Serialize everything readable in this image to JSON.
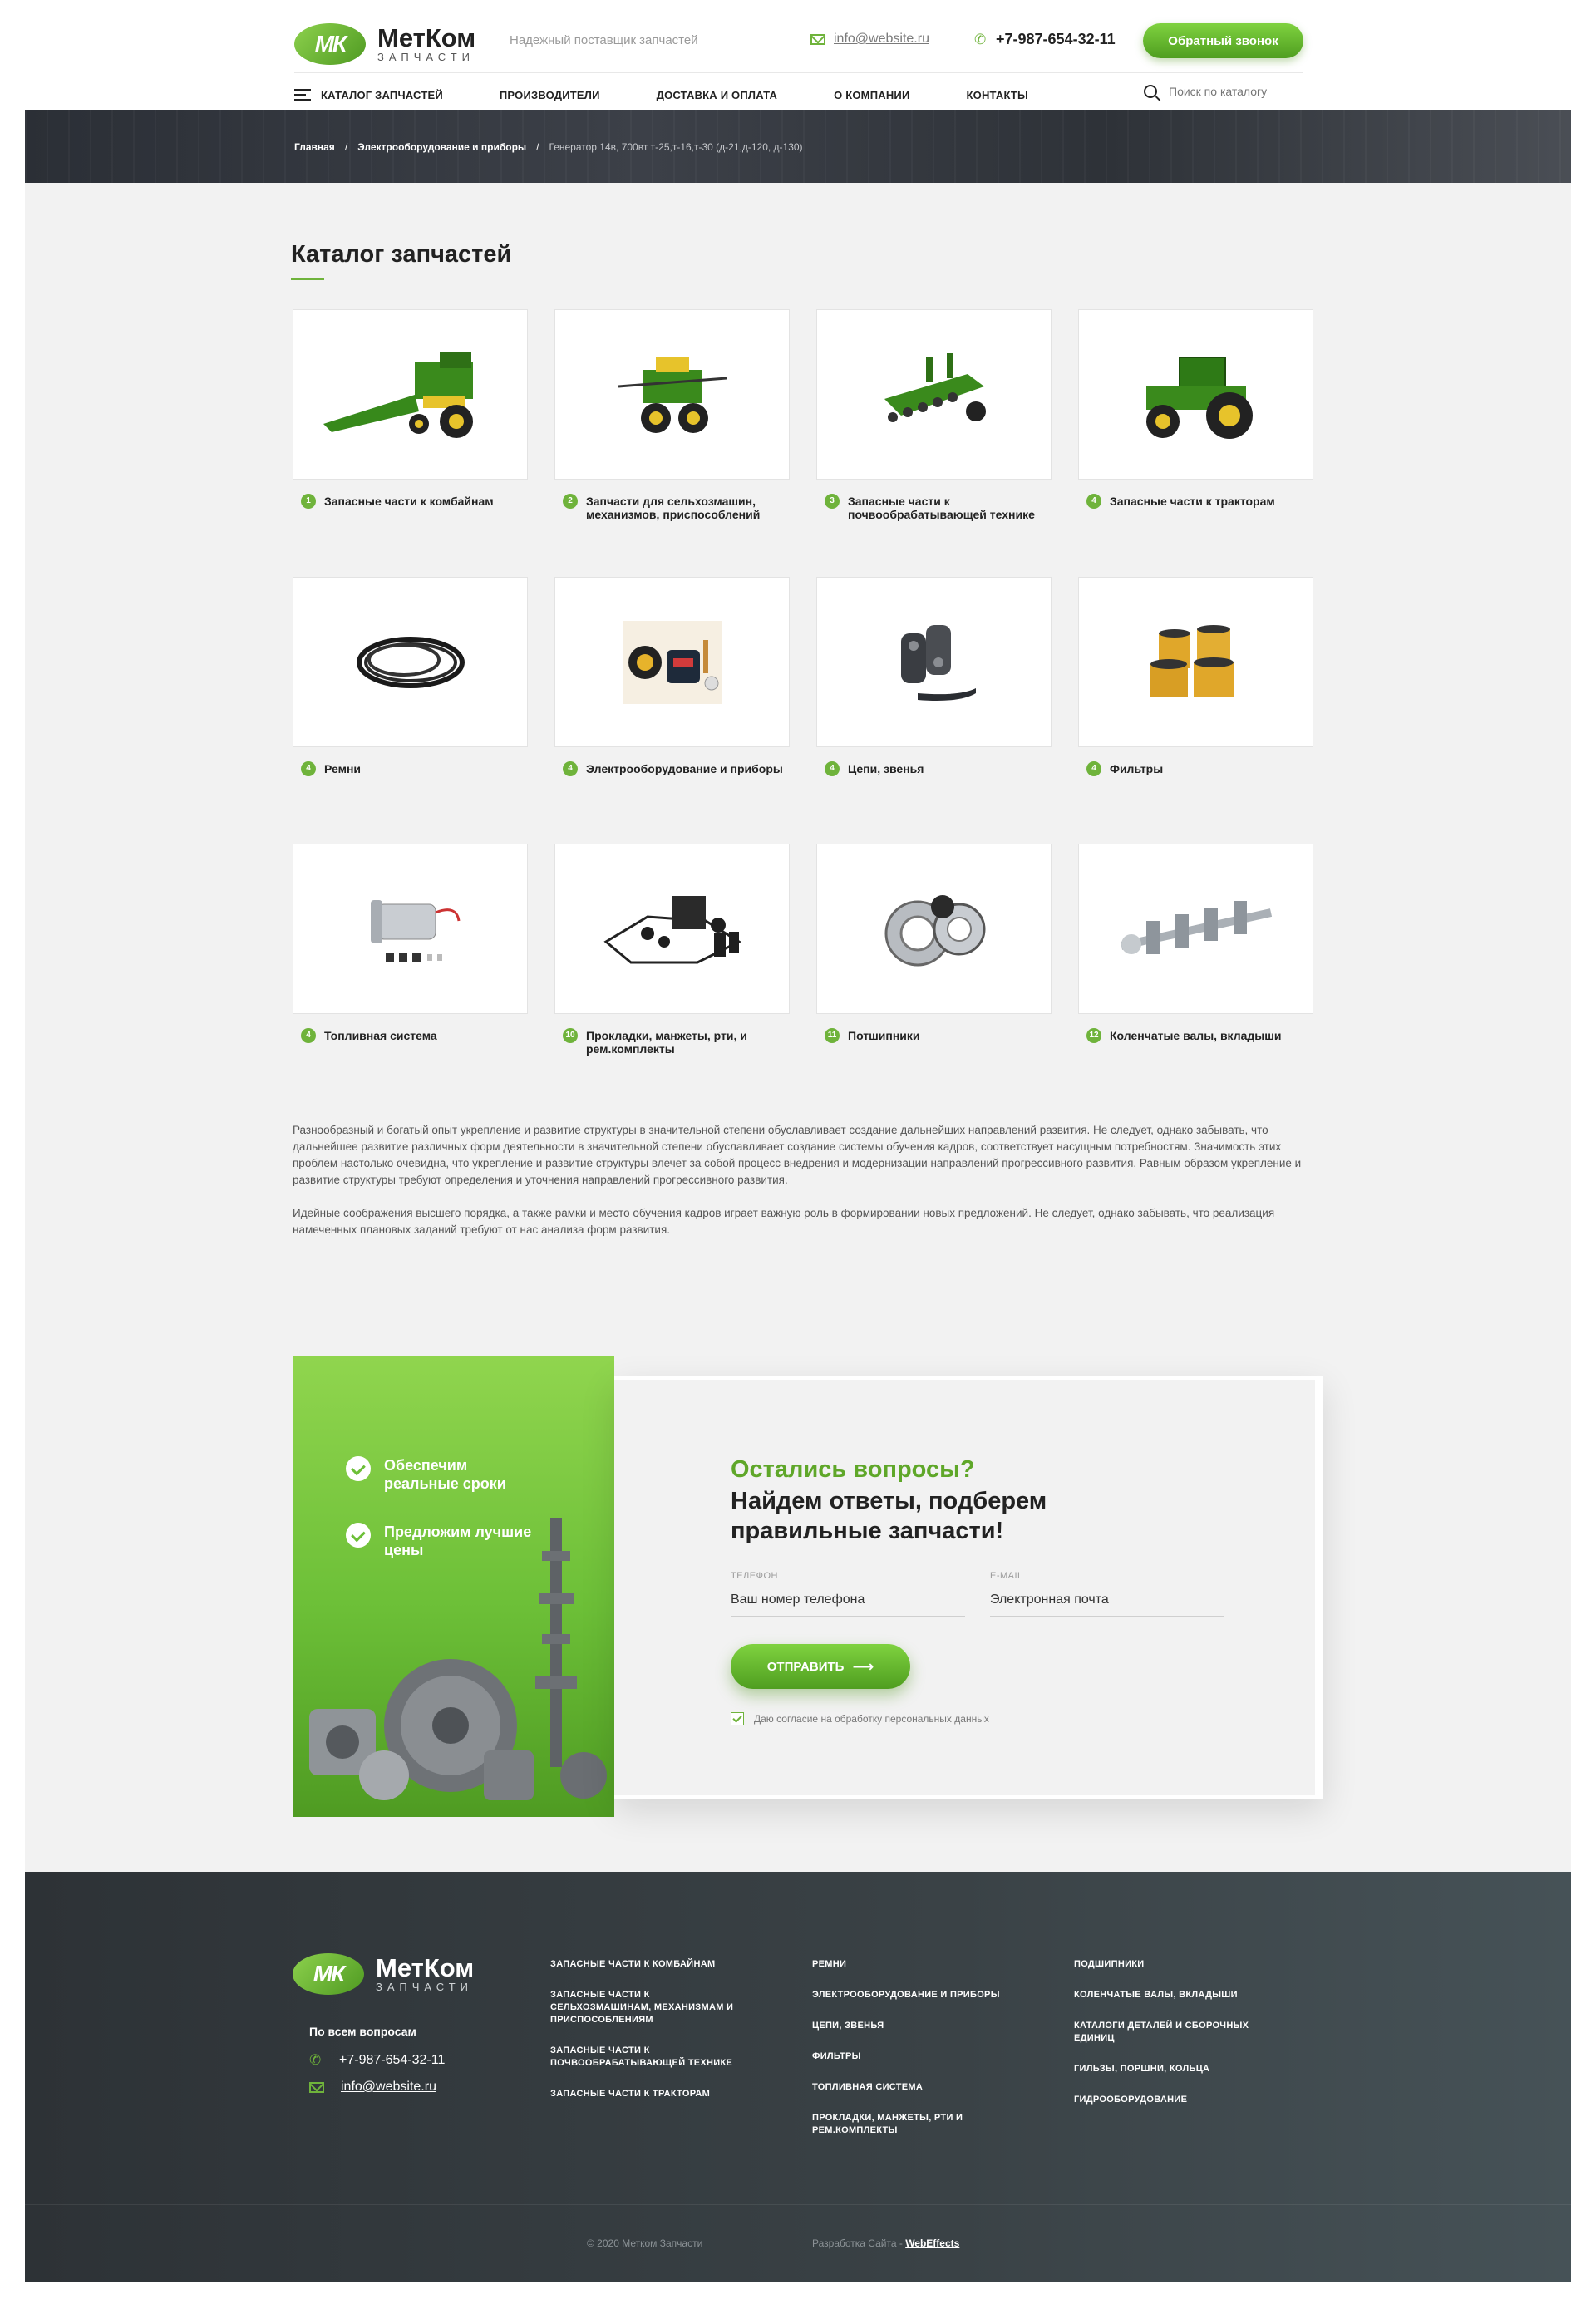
{
  "header": {
    "logo_mark": "МК",
    "logo_name": "МетКом",
    "logo_sub": "запчасти",
    "tagline": "Надежный поставщик запчастей",
    "email": "info@website.ru",
    "phone": "+7-987-654-32-11",
    "callback_button": "Обратный звонок"
  },
  "nav": {
    "items": [
      "Каталог запчастей",
      "Производители",
      "Доставка и оплата",
      "О компании",
      "Контакты"
    ],
    "search_placeholder": "Поиск по каталогу"
  },
  "breadcrumb": {
    "home": "Главная",
    "section": "Электрооборудование и приборы",
    "current": "Генератор 14в, 700вт т-25,т-16,т-30 (д-21,д-120, д-130)"
  },
  "catalog": {
    "title": "Каталог запчастей",
    "items": [
      {
        "num": "1",
        "label": "Запасные части к комбайнам",
        "icon": "combine-harvester-image"
      },
      {
        "num": "2",
        "label": "Запчасти для сельхозмашин, механизмов, приспособлений",
        "icon": "sprayer-image"
      },
      {
        "num": "3",
        "label": "Запасные части к почвообрабатывающей технике",
        "icon": "seeder-image"
      },
      {
        "num": "4",
        "label": "Запасные части к тракторам",
        "icon": "tractor-image"
      },
      {
        "num": "4",
        "label": "Ремни",
        "icon": "belts-image"
      },
      {
        "num": "4",
        "label": "Электрооборудование и приборы",
        "icon": "electrical-devices-image"
      },
      {
        "num": "4",
        "label": "Цепи, звенья",
        "icon": "chain-links-image"
      },
      {
        "num": "4",
        "label": "Фильтры",
        "icon": "filters-image"
      },
      {
        "num": "4",
        "label": "Топливная система",
        "icon": "fuel-pump-image"
      },
      {
        "num": "10",
        "label": "Прокладки, манжеты, рти, и рем.комплекты",
        "icon": "gaskets-image"
      },
      {
        "num": "11",
        "label": "Потшипники",
        "icon": "bearings-image"
      },
      {
        "num": "12",
        "label": "Коленчатые валы, вкладыши",
        "icon": "crankshaft-image"
      }
    ]
  },
  "description": {
    "p1": "Разнообразный и богатый опыт укрепление и развитие структуры в значительной степени обуславливает создание дальнейших направлений развития. Не следует, однако забывать, что дальнейшее развитие различных форм деятельности в значительной степени обуславливает создание системы обучения кадров, соответствует насущным потребностям. Значимость этих проблем настолько очевидна, что укрепление и развитие структуры влечет за собой процесс внедрения и модернизации направлений прогрессивного развития. Равным образом укрепление и развитие структуры требуют определения и уточнения направлений прогрессивного развития.",
    "p2": "Идейные соображения высшего порядка, а также рамки и место обучения кадров играет важную роль в формировании новых предложений. Не следует, однако забывать, что реализация намеченных плановых заданий требуют от нас анализа форм развития."
  },
  "promo": {
    "benefit1": "Обеспечим реальные сроки",
    "benefit2": "Предложим лучшие цены"
  },
  "form": {
    "question": "Остались вопросы?",
    "heading": "Найдем ответы, подберем правильные запчасти!",
    "phone_label": "Телефон",
    "phone_placeholder": "Ваш номер телефона",
    "email_label": "E-mail",
    "email_placeholder": "Электронная почта",
    "submit": "Отправить",
    "consent": "Даю согласие на обработку персональных данных"
  },
  "footer": {
    "logo_mark": "МК",
    "logo_name": "МетКом",
    "logo_sub": "запчасти",
    "contacts_label": "По всем вопросам",
    "phone": "+7-987-654-32-11",
    "email": "info@website.ru",
    "col1": [
      "Запасные части к комбайнам",
      "Запасные части к сельхозмашинам, механизмам и приспособлениям",
      "Запасные части к почвообрабатывающей технике",
      "Запасные части к тракторам"
    ],
    "col2": [
      "Ремни",
      "Электрооборудование и приборы",
      "Цепи, звенья",
      "Фильтры",
      "Топливная система",
      "Прокладки, манжеты, рти и рем.комплекты"
    ],
    "col3": [
      "Подшипники",
      "Коленчатые валы, вкладыши",
      "Каталоги деталей и сборочных единиц",
      "Гильзы, поршни, кольца",
      "Гидрооборудование"
    ],
    "copyright": "© 2020 Метком Запчасти",
    "dev_prefix": "Разработка Сайта -",
    "dev_name": "WebEffects"
  },
  "colors": {
    "accent": "#6fb33b",
    "accent_dark": "#4f9e20",
    "dark": "#2d3236",
    "background": "#f2f2f2"
  }
}
